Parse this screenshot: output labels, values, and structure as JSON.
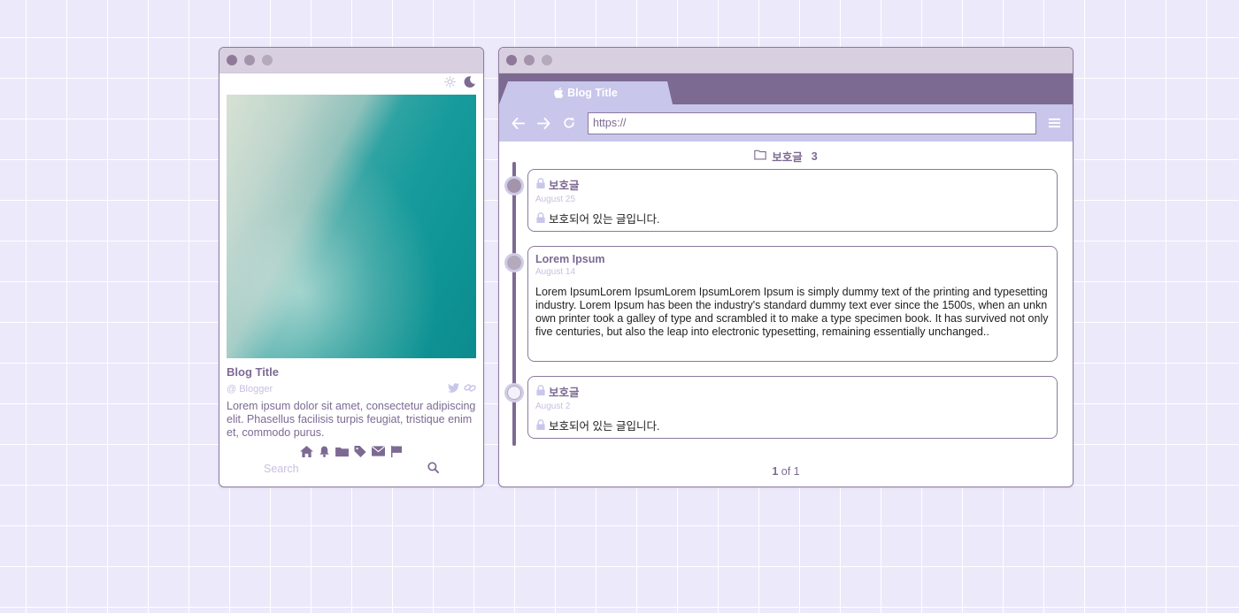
{
  "left_window": {
    "theme_icons": [
      "sun-icon",
      "moon-icon"
    ],
    "blog_title": "Blog Title",
    "author": "@ Blogger",
    "description": "Lorem ipsum dolor sit amet, consectetur adipiscing elit. Phasellus facilisis turpis feugiat, tristique enim et, commodo purus.",
    "nav_icons": [
      "home-icon",
      "bell-icon",
      "folder-icon",
      "tag-icon",
      "mail-icon",
      "flag-icon"
    ],
    "search_placeholder": "Search"
  },
  "right_window": {
    "tab_label": "Blog Title",
    "url_value": "https://",
    "category": {
      "name": "보호글",
      "count": "3"
    },
    "posts": [
      {
        "title": "보호글",
        "date": "August 25",
        "body": "보호되어 있는 글입니다.",
        "protected": true
      },
      {
        "title": "Lorem Ipsum",
        "date": "August 14",
        "body": "Lorem IpsumLorem IpsumLorem IpsumLorem Ipsum is simply dummy text of the printing and typesetting industry. Lorem Ipsum has been the industry's standard dummy text ever since the 1500s, when an unknown printer took a galley of type and scrambled it to make a type specimen book. It has survived not only five centuries, but also the leap into electronic typesetting, remaining essentially unchanged..",
        "protected": false
      },
      {
        "title": "보호글",
        "date": "August 2",
        "body": "보호되어 있는 글입니다.",
        "protected": true
      }
    ],
    "pager": {
      "current": "1",
      "of_label": "of 1"
    }
  },
  "colors": {
    "accent": "#7d6a93",
    "light_accent": "#c9c6eb",
    "tabbar": "#7c6a92",
    "background": "#ece9fb"
  }
}
